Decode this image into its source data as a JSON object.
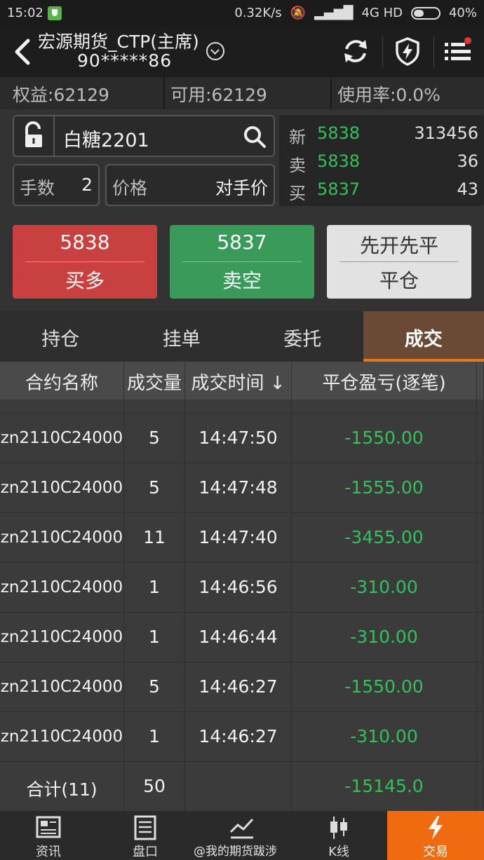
{
  "status_bar": {
    "time": "15:02",
    "speed": "0.32K/s",
    "network": "4G HD",
    "battery": "40%"
  },
  "header": {
    "title": "宏源期货_CTP(主席)",
    "account": "90*****86"
  },
  "account_bar": {
    "equity": "权益:62129",
    "available": "可用:62129",
    "usage": "使用率:0.0%"
  },
  "order": {
    "symbol": "白糖2201",
    "qty_label": "手数",
    "qty_value": "2",
    "price_label": "价格",
    "price_value": "对手价"
  },
  "quote": {
    "last_label": "新",
    "last_price": "5838",
    "last_vol": "313456",
    "ask_label": "卖",
    "ask_price": "5838",
    "ask_vol": "36",
    "bid_label": "买",
    "bid_price": "5837",
    "bid_vol": "43"
  },
  "buttons": {
    "buy_price": "5838",
    "buy_label": "买多",
    "sell_price": "5837",
    "sell_label": "卖空",
    "close_mode": "先开先平",
    "close_label": "平仓"
  },
  "tabs": [
    "持仓",
    "挂单",
    "委托",
    "成交"
  ],
  "table": {
    "headers": [
      "合约名称",
      "成交量",
      "成交时间 ↓",
      "平仓盈亏(逐笔)"
    ],
    "rows": [
      {
        "name": "zn2110C24000",
        "qty": "5",
        "time": "14:47:50",
        "pnl": "-1550.00"
      },
      {
        "name": "zn2110C24000",
        "qty": "5",
        "time": "14:47:48",
        "pnl": "-1555.00"
      },
      {
        "name": "zn2110C24000",
        "qty": "11",
        "time": "14:47:40",
        "pnl": "-3455.00"
      },
      {
        "name": "zn2110C24000",
        "qty": "1",
        "time": "14:46:56",
        "pnl": "-310.00"
      },
      {
        "name": "zn2110C24000",
        "qty": "1",
        "time": "14:46:44",
        "pnl": "-310.00"
      },
      {
        "name": "zn2110C24000",
        "qty": "5",
        "time": "14:46:27",
        "pnl": "-1550.00"
      },
      {
        "name": "zn2110C24000",
        "qty": "1",
        "time": "14:46:27",
        "pnl": "-310.00"
      }
    ],
    "total": {
      "name": "合计(11)",
      "qty": "50",
      "time": "",
      "pnl": "-15145.0"
    }
  },
  "nav": [
    {
      "label": "资讯",
      "icon": "news-icon"
    },
    {
      "label": "盘口",
      "icon": "orderbook-icon"
    },
    {
      "label": "",
      "icon": "chart-line-icon"
    },
    {
      "label": "K线",
      "icon": "candlestick-icon"
    },
    {
      "label": "交易",
      "icon": "lightning-icon"
    }
  ],
  "watermark": "@我的期货跋涉",
  "colors": {
    "up_green": "#2fc35a",
    "buy_red": "#c8403f",
    "sell_green": "#3a9a5a",
    "accent_orange": "#f06a0f"
  }
}
